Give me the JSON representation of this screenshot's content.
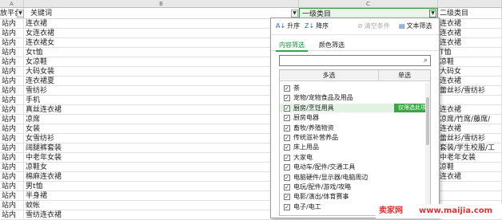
{
  "columns": {
    "a": "A",
    "b": "B",
    "c": "C"
  },
  "headers": {
    "a": "放平台",
    "b": "关键词",
    "c": "一级类目",
    "d": "二级类目"
  },
  "rows": [
    {
      "a": "站内",
      "b": "连衣裙",
      "d": "连衣裙"
    },
    {
      "a": "站内",
      "b": "女连衣裙",
      "d": "连衣裙"
    },
    {
      "a": "站内",
      "b": "连衣裙女",
      "d": "连衣裙"
    },
    {
      "a": "站内",
      "b": "女t恤",
      "d": "T恤"
    },
    {
      "a": "站内",
      "b": "女凉鞋",
      "d": "凉鞋"
    },
    {
      "a": "站内",
      "b": "大码女装",
      "d": "大码女"
    },
    {
      "a": "站内",
      "b": "连衣裙夏",
      "d": "连衣裙"
    },
    {
      "a": "站内",
      "b": "雪纺衫",
      "d": "蕾丝衫/雪纺衫"
    },
    {
      "a": "站内",
      "b": "手机",
      "d": ""
    },
    {
      "a": "站内",
      "b": "真丝连衣裙",
      "d": "连衣裙"
    },
    {
      "a": "站内",
      "b": "凉席",
      "d": "凉席/竹席/藤席/"
    },
    {
      "a": "站内",
      "b": "女装",
      "d": "连衣裙"
    },
    {
      "a": "站内",
      "b": "女雪纺衫",
      "d": "蕾丝衫/雪纺衫"
    },
    {
      "a": "站内",
      "b": "阔腿裤套装",
      "d": "套装/学生校服/工"
    },
    {
      "a": "站内",
      "b": "中老年女装",
      "d": "中老年女装"
    },
    {
      "a": "站内",
      "b": "凉鞋女",
      "d": "凉鞋"
    },
    {
      "a": "站内",
      "b": "棉麻连衣裙",
      "d": "连衣裙"
    },
    {
      "a": "站内",
      "b": "男t恤",
      "d": ""
    },
    {
      "a": "站内",
      "b": "半身裙",
      "d": ""
    },
    {
      "a": "站内",
      "b": "蚊帐",
      "d": ""
    },
    {
      "a": "站内",
      "b": "雪纺连衣裙",
      "d": ""
    }
  ],
  "filter": {
    "sort_asc": "升序",
    "sort_desc": "降序",
    "clear": "清空条件",
    "text_filter": "文本筛选",
    "tab_content": "内容筛选",
    "tab_color": "颜色筛选",
    "search_placeholder": "",
    "col_multi": "多选",
    "col_single": "单选",
    "only_tag": "仅筛选此项",
    "items": [
      {
        "label": "茶",
        "checked": true
      },
      {
        "label": "宠物/宠物食品及用品",
        "checked": true
      },
      {
        "label": "厨房/烹饪用具",
        "checked": true
      },
      {
        "label": "厨房电器",
        "checked": true
      },
      {
        "label": "畜牧/养殖物资",
        "checked": true
      },
      {
        "label": "传统滋补营养品",
        "checked": true
      },
      {
        "label": "床上用品",
        "checked": true
      },
      {
        "label": "大家电",
        "checked": true
      },
      {
        "label": "电动车/配件/交通工具",
        "checked": true
      },
      {
        "label": "电脑硬件/显示器/电脑周边",
        "checked": true
      },
      {
        "label": "电玩/配件/游戏/攻略",
        "checked": true
      },
      {
        "label": "电影/演出/体育赛事",
        "checked": true
      },
      {
        "label": "电子/电工",
        "checked": true
      }
    ]
  },
  "watermark": {
    "site": "卖家网",
    "url": "www.maijia.com"
  }
}
